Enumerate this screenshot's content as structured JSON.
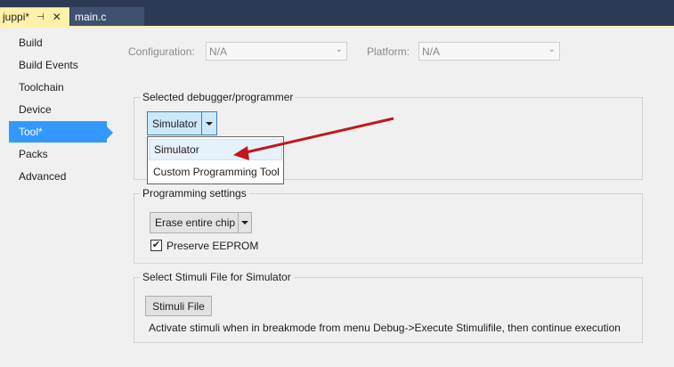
{
  "tabs": [
    {
      "label": "juppi*",
      "pin_glyph": "⊣",
      "close_glyph": "✕"
    },
    {
      "label": "main.c"
    }
  ],
  "nav": {
    "items": [
      "Build",
      "Build Events",
      "Toolchain",
      "Device",
      "Tool*",
      "Packs",
      "Advanced"
    ],
    "active": "Tool*"
  },
  "config": {
    "configuration_label": "Configuration:",
    "configuration_value": "N/A",
    "platform_label": "Platform:",
    "platform_value": "N/A"
  },
  "debugger": {
    "group_title": "Selected debugger/programmer",
    "selected": "Simulator",
    "options": [
      "Simulator",
      "Custom Programming Tool"
    ]
  },
  "programming": {
    "group_title": "Programming settings",
    "erase_value": "Erase entire chip",
    "preserve_label": "Preserve EEPROM",
    "preserve_checked": true
  },
  "stimuli": {
    "group_title": "Select Stimuli File for Simulator",
    "button_label": "Stimuli File",
    "hint": "Activate stimuli when in breakmode from menu Debug->Execute Stimulifile, then continue execution"
  },
  "colors": {
    "accent": "#3399ff",
    "active_tab": "#fff1a8",
    "annotation_arrow": "#c0161c"
  }
}
